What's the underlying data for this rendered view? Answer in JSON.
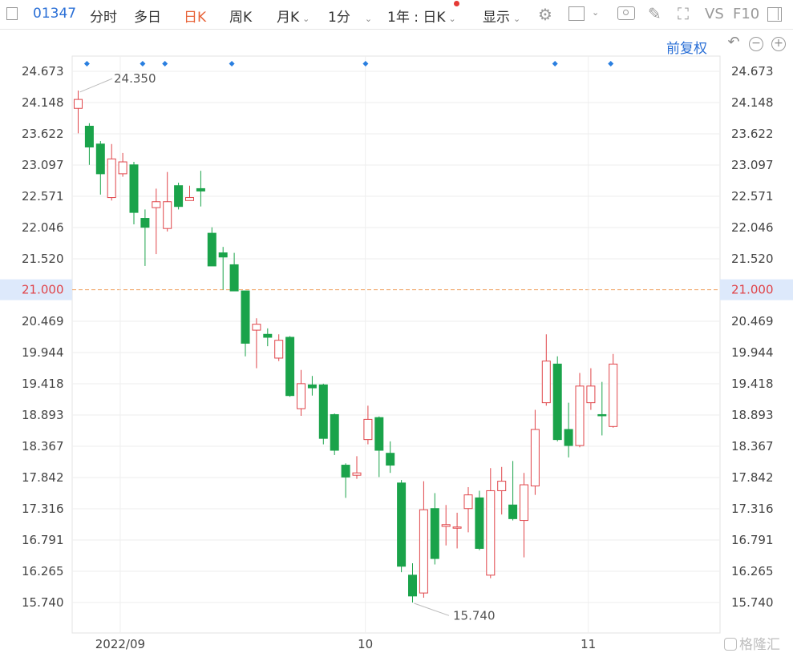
{
  "toolbar": {
    "code": "01347",
    "tabs": [
      "分时",
      "多日",
      "日K",
      "周K",
      "月K",
      "1分"
    ],
    "active_tab": "日K",
    "range_label": "1年 : 日K",
    "display_label": "显示",
    "vs_label": "VS",
    "f10_label": "F10"
  },
  "sub": {
    "adjust_label": "前复权"
  },
  "watermark": "格隆汇",
  "chart_data": {
    "type": "candlestick",
    "y_ticks": [
      "24.673",
      "24.148",
      "23.622",
      "23.097",
      "22.571",
      "22.046",
      "21.520",
      "21.000",
      "20.469",
      "19.944",
      "19.418",
      "18.893",
      "18.367",
      "17.842",
      "17.316",
      "16.791",
      "16.265",
      "15.740"
    ],
    "ylim": [
      15.74,
      24.673
    ],
    "x_ticks": [
      "2022/09",
      "10",
      "11"
    ],
    "current_price": "21.000",
    "max_label": "24.350",
    "min_label": "15.740",
    "colors": {
      "up": "#e0454a",
      "down": "#1aa34a",
      "current_line": "#f0a060",
      "dots": "#2a7fe0"
    },
    "candles": [
      {
        "open": 24.05,
        "close": 24.2,
        "high": 24.35,
        "low": 23.63
      },
      {
        "open": 23.75,
        "close": 23.4,
        "high": 23.8,
        "low": 23.1
      },
      {
        "open": 23.45,
        "close": 22.95,
        "high": 23.5,
        "low": 22.6
      },
      {
        "open": 22.55,
        "close": 23.2,
        "high": 23.45,
        "low": 22.5
      },
      {
        "open": 22.95,
        "close": 23.15,
        "high": 23.3,
        "low": 22.9
      },
      {
        "open": 23.1,
        "close": 22.3,
        "high": 23.15,
        "low": 22.1
      },
      {
        "open": 22.2,
        "close": 22.05,
        "high": 22.35,
        "low": 21.4
      },
      {
        "open": 22.38,
        "close": 22.48,
        "high": 22.7,
        "low": 21.6
      },
      {
        "open": 22.03,
        "close": 22.48,
        "high": 22.98,
        "low": 21.98
      },
      {
        "open": 22.75,
        "close": 22.4,
        "high": 22.8,
        "low": 22.35
      },
      {
        "open": 22.5,
        "close": 22.55,
        "high": 22.75,
        "low": 22.5
      },
      {
        "open": 22.7,
        "close": 22.66,
        "high": 23.0,
        "low": 22.4
      },
      {
        "open": 21.95,
        "close": 21.4,
        "high": 22.05,
        "low": 21.4
      },
      {
        "open": 21.62,
        "close": 21.55,
        "high": 21.72,
        "low": 21.0
      },
      {
        "open": 21.42,
        "close": 20.98,
        "high": 21.62,
        "low": 20.98
      },
      {
        "open": 20.98,
        "close": 20.1,
        "high": 20.98,
        "low": 19.88
      },
      {
        "open": 20.32,
        "close": 20.42,
        "high": 20.52,
        "low": 19.68
      },
      {
        "open": 20.25,
        "close": 20.2,
        "high": 20.35,
        "low": 20.05
      },
      {
        "open": 19.85,
        "close": 20.15,
        "high": 20.25,
        "low": 19.8
      },
      {
        "open": 20.2,
        "close": 19.22,
        "high": 20.22,
        "low": 19.2
      },
      {
        "open": 19.0,
        "close": 19.42,
        "high": 19.65,
        "low": 18.88
      },
      {
        "open": 19.4,
        "close": 19.35,
        "high": 19.55,
        "low": 19.22
      },
      {
        "open": 19.4,
        "close": 18.5,
        "high": 19.42,
        "low": 18.4
      },
      {
        "open": 18.9,
        "close": 18.3,
        "high": 18.92,
        "low": 18.22
      },
      {
        "open": 18.05,
        "close": 17.85,
        "high": 18.08,
        "low": 17.5
      },
      {
        "open": 17.88,
        "close": 17.92,
        "high": 18.2,
        "low": 17.82
      },
      {
        "open": 18.48,
        "close": 18.82,
        "high": 19.05,
        "low": 18.4
      },
      {
        "open": 18.85,
        "close": 18.3,
        "high": 18.87,
        "low": 17.85
      },
      {
        "open": 18.25,
        "close": 18.05,
        "high": 18.45,
        "low": 17.92
      },
      {
        "open": 17.75,
        "close": 16.35,
        "high": 17.8,
        "low": 16.25
      },
      {
        "open": 16.2,
        "close": 15.85,
        "high": 16.4,
        "low": 15.74
      },
      {
        "open": 15.9,
        "close": 17.3,
        "high": 17.78,
        "low": 15.82
      },
      {
        "open": 17.32,
        "close": 16.48,
        "high": 17.58,
        "low": 16.38
      },
      {
        "open": 17.02,
        "close": 17.05,
        "high": 17.38,
        "low": 16.7
      },
      {
        "open": 17.0,
        "close": 17.01,
        "high": 17.25,
        "low": 16.65
      },
      {
        "open": 17.32,
        "close": 17.55,
        "high": 17.68,
        "low": 16.92
      },
      {
        "open": 17.5,
        "close": 16.65,
        "high": 17.62,
        "low": 16.62
      },
      {
        "open": 16.2,
        "close": 17.62,
        "high": 18.0,
        "low": 16.15
      },
      {
        "open": 17.62,
        "close": 17.78,
        "high": 18.02,
        "low": 17.22
      },
      {
        "open": 17.38,
        "close": 17.15,
        "high": 18.12,
        "low": 17.12
      },
      {
        "open": 17.12,
        "close": 17.72,
        "high": 17.92,
        "low": 16.5
      },
      {
        "open": 17.7,
        "close": 18.65,
        "high": 18.98,
        "low": 17.55
      },
      {
        "open": 19.1,
        "close": 19.8,
        "high": 20.25,
        "low": 19.05
      },
      {
        "open": 19.75,
        "close": 18.48,
        "high": 19.88,
        "low": 18.45
      },
      {
        "open": 18.65,
        "close": 18.38,
        "high": 19.1,
        "low": 18.18
      },
      {
        "open": 18.38,
        "close": 19.38,
        "high": 19.6,
        "low": 18.35
      },
      {
        "open": 19.1,
        "close": 19.38,
        "high": 19.68,
        "low": 18.98
      },
      {
        "open": 18.9,
        "close": 18.89,
        "high": 19.45,
        "low": 18.55
      },
      {
        "open": 18.7,
        "close": 19.75,
        "high": 19.92,
        "low": 18.68
      }
    ]
  }
}
